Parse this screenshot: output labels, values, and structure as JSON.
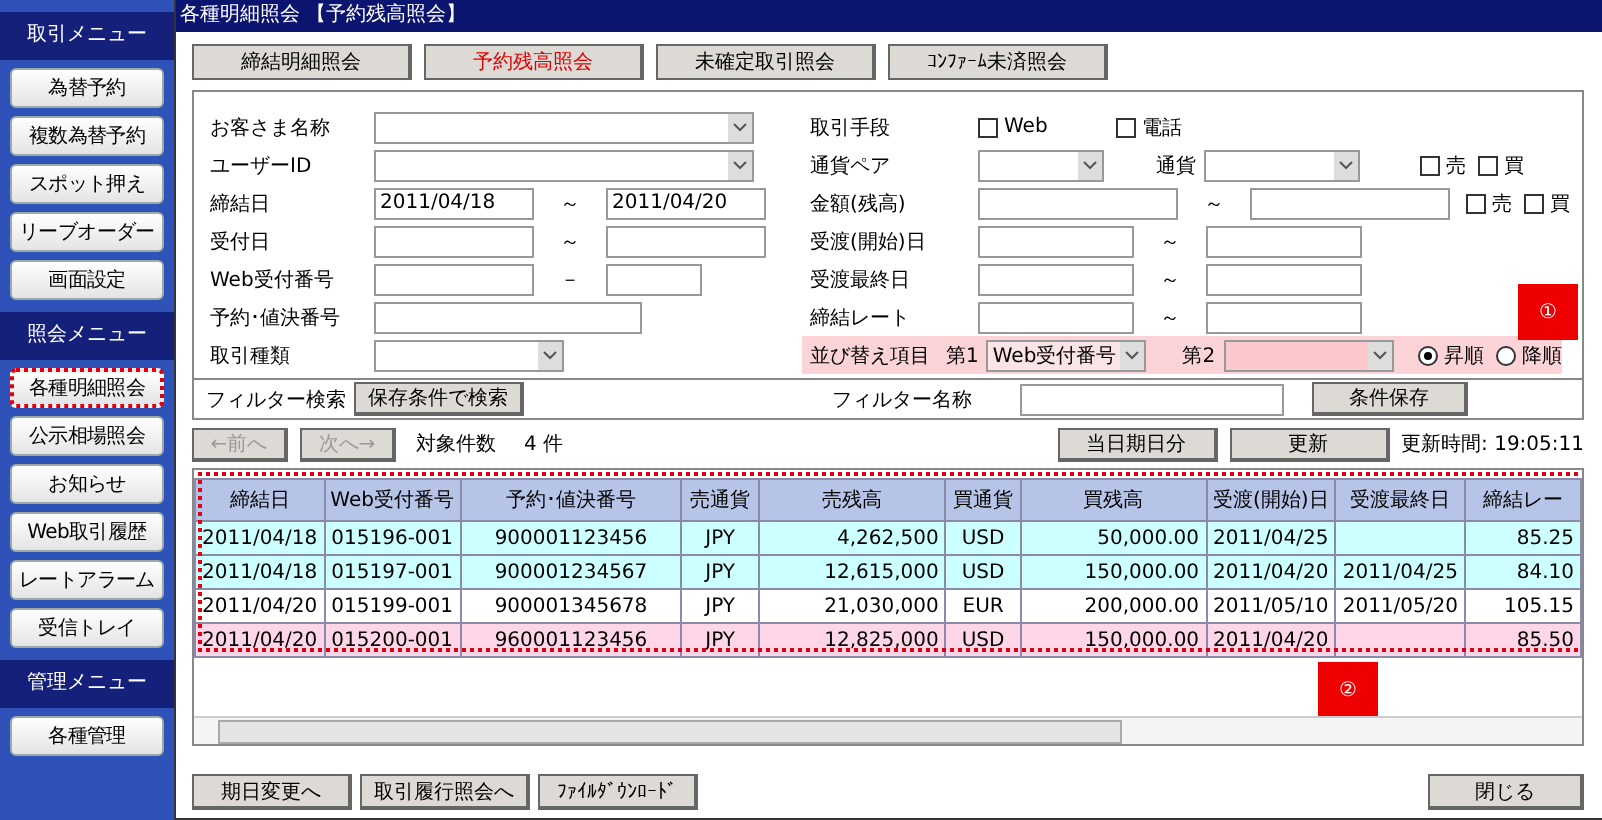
{
  "sidebar": {
    "sections": [
      {
        "title": "取引メニュー",
        "items": [
          {
            "label": "為替予約",
            "selected": false
          },
          {
            "label": "複数為替予約",
            "selected": false
          },
          {
            "label": "スポット押え",
            "selected": false
          },
          {
            "label": "リーブオーダー",
            "selected": false
          },
          {
            "label": "画面設定",
            "selected": false
          }
        ]
      },
      {
        "title": "照会メニュー",
        "items": [
          {
            "label": "各種明細照会",
            "selected": true
          },
          {
            "label": "公示相場照会",
            "selected": false
          },
          {
            "label": "お知らせ",
            "selected": false
          },
          {
            "label": "Web取引履歴",
            "selected": false
          },
          {
            "label": "レートアラーム",
            "selected": false
          },
          {
            "label": "受信トレイ",
            "selected": false
          }
        ]
      },
      {
        "title": "管理メニュー",
        "items": [
          {
            "label": "各種管理",
            "selected": false
          }
        ]
      }
    ]
  },
  "window": {
    "title": "各種明細照会 【予約残高照会】"
  },
  "tabs": [
    {
      "label": "締結明細照会",
      "selected": false
    },
    {
      "label": "予約残高照会",
      "selected": true
    },
    {
      "label": "未確定取引照会",
      "selected": false
    },
    {
      "label": "ｺﾝﾌｧｰﾑ未済照会",
      "selected": false
    }
  ],
  "form": {
    "left": [
      {
        "kind": "select",
        "label": "お客さま名称"
      },
      {
        "kind": "select",
        "label": "ユーザーID"
      },
      {
        "kind": "range",
        "label": "締結日",
        "from": "2011/04/18",
        "separator": "～",
        "to": "2011/04/20"
      },
      {
        "kind": "range",
        "label": "受付日",
        "separator": "～"
      },
      {
        "kind": "short-range",
        "label": "Web受付番号",
        "separator": "－"
      },
      {
        "kind": "input",
        "label": "予約･値決番号"
      },
      {
        "kind": "short-select",
        "label": "取引種類"
      }
    ],
    "right": [
      {
        "kind": "checks",
        "label": "取引手段",
        "options": [
          {
            "label": "Web",
            "checked": false
          },
          {
            "label": "電話",
            "checked": false
          }
        ]
      },
      {
        "kind": "pair",
        "label": "通貨ペア",
        "label_2": "通貨",
        "options": [
          {
            "label": "売",
            "checked": false
          },
          {
            "label": "買",
            "checked": false
          }
        ]
      },
      {
        "kind": "amount",
        "label": "金額(残高)",
        "separator": "～",
        "options": [
          {
            "label": "売",
            "checked": false
          },
          {
            "label": "買",
            "checked": false
          }
        ]
      },
      {
        "kind": "range",
        "label": "受渡(開始)日",
        "separator": "～"
      },
      {
        "kind": "range",
        "label": "受渡最終日",
        "separator": "～"
      },
      {
        "kind": "range",
        "label": "締結レート",
        "separator": "～"
      }
    ],
    "sort": {
      "label": "並び替え項目",
      "first_label": "第1",
      "first_value": "Web受付番号",
      "second_label": "第2",
      "orders": [
        {
          "label": "昇順",
          "selected": true
        },
        {
          "label": "降順",
          "selected": false
        }
      ]
    },
    "callout": "①",
    "filter": {
      "label": "フィルター検索",
      "search_button": "保存条件で検索",
      "name_label": "フィルター名称",
      "save_button": "条件保存"
    }
  },
  "nav": {
    "prev": {
      "label": "←前へ",
      "disabled": true
    },
    "next": {
      "label": "次へ→",
      "disabled": true
    },
    "count_label": "対象件数",
    "count": "4 件",
    "today_button": "当日期日分",
    "refresh_button": "更新",
    "updated": "更新時間: 19:05:11"
  },
  "table": {
    "columns": [
      "締結日",
      "Web受付番号",
      "予約･値決番号",
      "売通貨",
      "売残高",
      "買通貨",
      "買残高",
      "受渡(開始)日",
      "受渡最終日",
      "締結レー"
    ],
    "rows": [
      {
        "color": "#ccffff",
        "cells": [
          "2011/04/18",
          "015196-001",
          "900001123456",
          "JPY",
          "4,262,500",
          "USD",
          "50,000.00",
          "2011/04/25",
          "",
          "85.25"
        ]
      },
      {
        "color": "#ccffff",
        "cells": [
          "2011/04/18",
          "015197-001",
          "900001234567",
          "JPY",
          "12,615,000",
          "USD",
          "150,000.00",
          "2011/04/20",
          "2011/04/25",
          "84.10"
        ]
      },
      {
        "color": "#ffffff",
        "cells": [
          "2011/04/20",
          "015199-001",
          "900001345678",
          "JPY",
          "21,030,000",
          "EUR",
          "200,000.00",
          "2011/05/10",
          "2011/05/20",
          "105.15"
        ]
      },
      {
        "color": "#ffd6e8",
        "cells": [
          "2011/04/20",
          "015200-001",
          "960001123456",
          "JPY",
          "12,825,000",
          "USD",
          "150,000.00",
          "2011/04/20",
          "",
          "85.50"
        ]
      }
    ],
    "callout": "②"
  },
  "footer": {
    "buttons": [
      "期日変更へ",
      "取引履行照会へ",
      "ﾌｧｲﾙﾀﾞｳﾝﾛｰﾄﾞ"
    ],
    "close": "閉じる"
  }
}
